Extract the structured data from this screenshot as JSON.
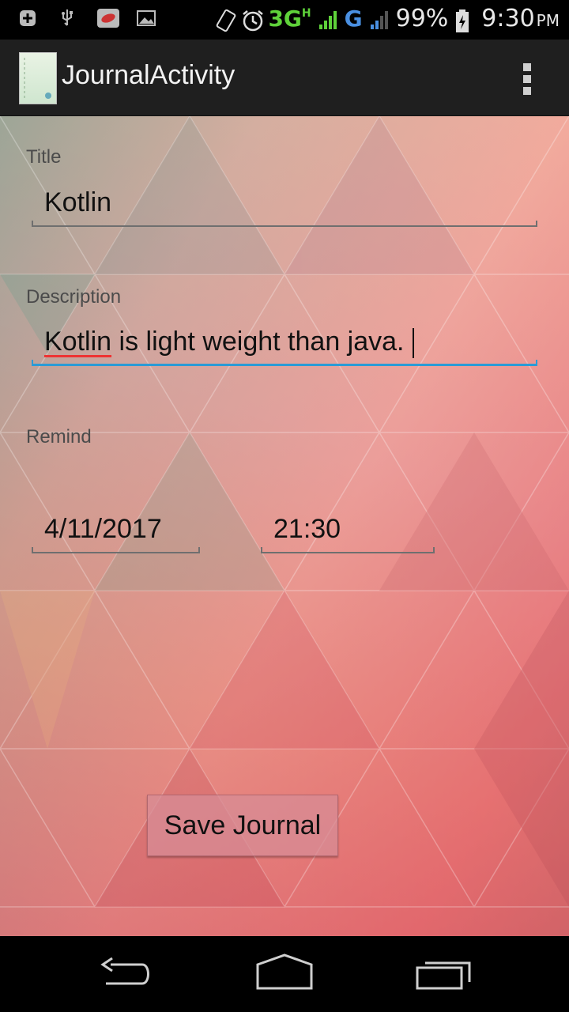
{
  "status_bar": {
    "network_3g": "3G",
    "network_h": "H",
    "network_g": "G",
    "battery": "99%",
    "time": "9:30",
    "time_suffix": "PM"
  },
  "action_bar": {
    "title": "JournalActivity"
  },
  "form": {
    "title_label": "Title",
    "title_value": "Kotlin",
    "description_label": "Description",
    "description_value_word": "Kotlin",
    "description_value_rest": " is light weight than java.",
    "remind_label": "Remind",
    "date_value": "4/11/2017",
    "time_value": "21:30",
    "save_button": "Save Journal"
  },
  "colors": {
    "focus_accent": "#2a9bd6",
    "spellcheck": "#ee3333"
  }
}
